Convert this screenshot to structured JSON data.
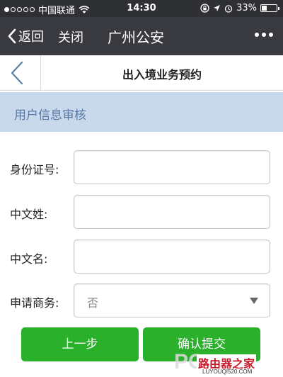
{
  "status_bar": {
    "carrier": "中国联通",
    "time": "14:30",
    "battery": "33%",
    "battery_level": 0.33,
    "signal_bars_filled": 1,
    "signal_bars_total": 5
  },
  "nav": {
    "back_label": "返回",
    "close_label": "关闭",
    "title": "广州公安"
  },
  "page": {
    "title": "出入境业务预约"
  },
  "section": {
    "title": "用户信息审核"
  },
  "form": {
    "id_label": "身份证号:",
    "id_value": "",
    "surname_label": "中文姓:",
    "surname_value": "",
    "given_name_label": "中文名:",
    "given_name_value": "",
    "business_label": "申请商务:",
    "business_value": "否"
  },
  "buttons": {
    "prev": "上一步",
    "submit": "确认提交"
  },
  "watermark": {
    "brand": "PC",
    "site_name": "路由器之家",
    "url": "LUYOUQI520.COM"
  },
  "colors": {
    "status_bar_bg": "#2f3034",
    "nav_bg": "#393a3f",
    "section_bg": "#c9d9ec",
    "section_text": "#5a78a6",
    "button_green": "#2bb02b"
  }
}
